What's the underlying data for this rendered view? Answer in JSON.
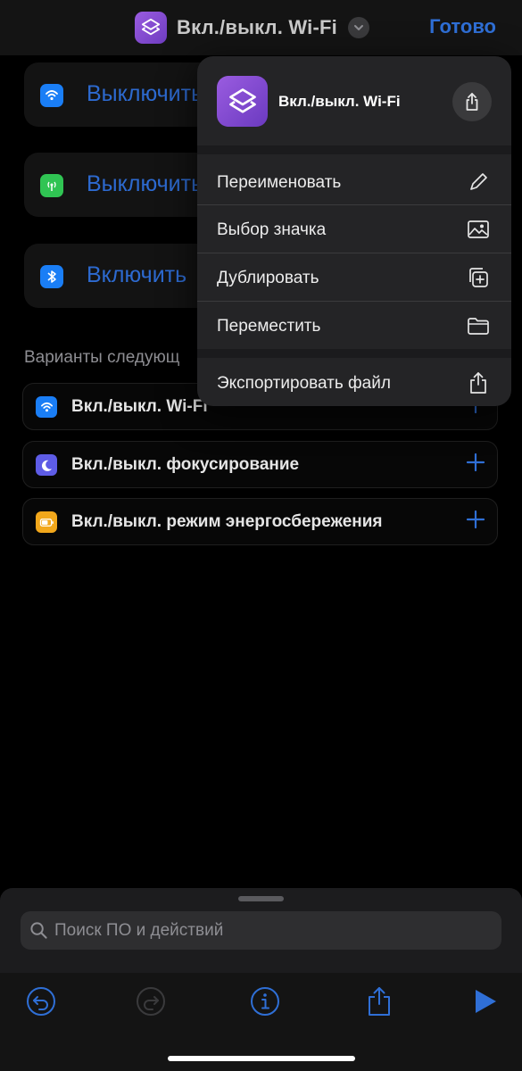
{
  "navbar": {
    "title": "Вкл./выкл. Wi-Fi",
    "done_label": "Готово",
    "app_icon": "shortcuts-layers-icon",
    "chevron_icon": "chevron-down-icon"
  },
  "actions": [
    {
      "label": "Выключить",
      "icon": "wifi-icon",
      "color": "#1a7ef6"
    },
    {
      "label": "Выключить",
      "icon": "cellular-antenna-icon",
      "color": "#30c453"
    },
    {
      "label": "Включить",
      "icon": "bluetooth-icon",
      "color": "#1a7ef6"
    }
  ],
  "suggestions": {
    "title": "Варианты следующ",
    "items": [
      {
        "label": "Вкл./выкл. Wi-Fi",
        "icon": "wifi-icon",
        "color": "#1a7ef6"
      },
      {
        "label": "Вкл./выкл. фокусирование",
        "icon": "moon-icon",
        "color": "#5e5ce6"
      },
      {
        "label": "Вкл./выкл. режим энергосбережения",
        "icon": "battery-icon",
        "color": "#f2a71b"
      }
    ]
  },
  "menu": {
    "shortcut_name": "Вкл./выкл. Wi-Fi",
    "items": [
      {
        "label": "Переименовать",
        "icon": "pencil-icon"
      },
      {
        "label": "Выбор значка",
        "icon": "image-icon"
      },
      {
        "label": "Дублировать",
        "icon": "duplicate-icon"
      },
      {
        "label": "Переместить",
        "icon": "folder-icon"
      },
      {
        "label": "Экспортировать файл",
        "icon": "share-icon"
      }
    ]
  },
  "search": {
    "placeholder": "Поиск ПО и действий"
  },
  "toolbar": {
    "buttons": [
      "undo-icon",
      "redo-icon",
      "info-icon",
      "share-icon",
      "play-icon"
    ]
  },
  "colors": {
    "accent": "#2f6fd6",
    "background": "#000000",
    "menu_bg": "#242426",
    "shortcut_purple": "#8a4fd8"
  }
}
